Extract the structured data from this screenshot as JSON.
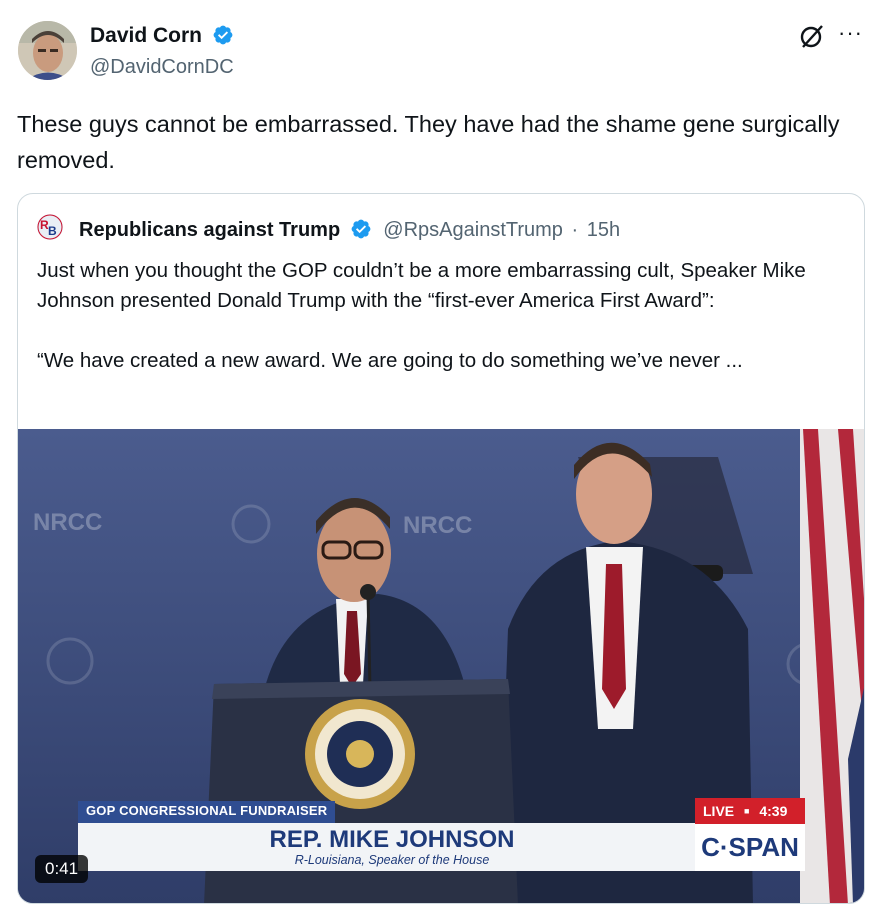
{
  "author": {
    "name": "David Corn",
    "handle": "@DavidCornDC"
  },
  "tweet": {
    "text": "These guys cannot be embarrassed. They have had the shame gene surgically removed."
  },
  "more_label": "···",
  "quote": {
    "name": "Republicans against Trump",
    "handle": "@RpsAgainstTrump",
    "separator": "·",
    "time": "15h",
    "text": "Just when you thought the GOP couldn’t be a more embarrassing cult, Speaker Mike Johnson presented Donald Trump with the “first-ever America First Award”:\n\n“We have created a new award. We are going to do something we’ve never ...",
    "avatar_text": "RB"
  },
  "video": {
    "duration": "0:41",
    "banner_label": "GOP CONGRESSIONAL FUNDRAISER",
    "banner_name": "REP. MIKE JOHNSON",
    "banner_sub": "R-Louisiana, Speaker of the House",
    "live_label": "LIVE",
    "live_time": "4:39",
    "network": "C·SPAN",
    "backdrop_text": "NRCC"
  },
  "colors": {
    "verified": "#1d9bf0",
    "text": "#0f1419",
    "secondary": "#536471",
    "border": "#cfd9de"
  }
}
